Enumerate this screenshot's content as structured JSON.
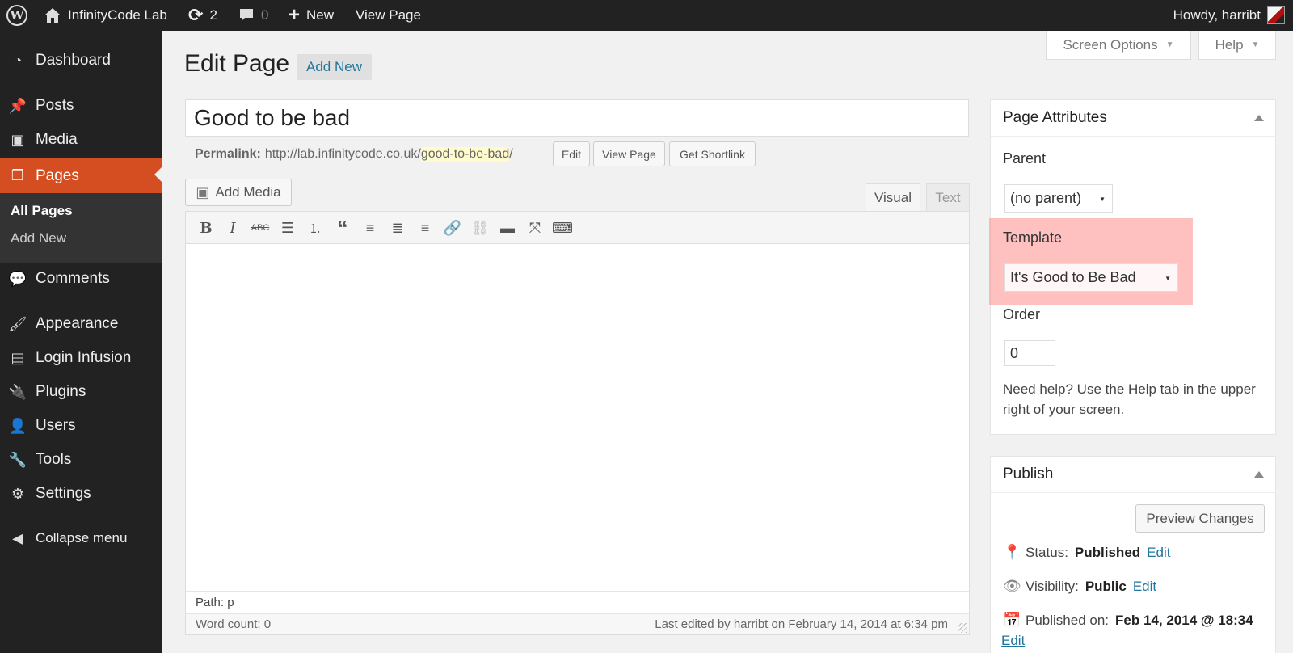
{
  "adminbar": {
    "site_name": "InfinityCode Lab",
    "updates_count": "2",
    "comments_count": "0",
    "new_label": "New",
    "view_page_label": "View Page",
    "howdy": "Howdy, harribt"
  },
  "sidebar": {
    "items": [
      {
        "label": "Dashboard",
        "icon": "dashboard-icon"
      },
      {
        "label": "Posts",
        "icon": "pushpin-icon"
      },
      {
        "label": "Media",
        "icon": "media-icon"
      },
      {
        "label": "Pages",
        "icon": "pages-icon"
      },
      {
        "label": "Comments",
        "icon": "comment-icon"
      },
      {
        "label": "Appearance",
        "icon": "brush-icon"
      },
      {
        "label": "Login Infusion",
        "icon": "plugin-custom-icon"
      },
      {
        "label": "Plugins",
        "icon": "plug-icon"
      },
      {
        "label": "Users",
        "icon": "user-icon"
      },
      {
        "label": "Tools",
        "icon": "wrench-icon"
      },
      {
        "label": "Settings",
        "icon": "settings-icon"
      }
    ],
    "submenu": [
      "All Pages",
      "Add New"
    ],
    "collapse_label": "Collapse menu"
  },
  "header": {
    "title": "Edit Page",
    "add_new": "Add New",
    "screen_options": "Screen Options",
    "help": "Help"
  },
  "post": {
    "title": "Good to be bad",
    "permalink_label": "Permalink:",
    "permalink_base": "http://lab.infinitycode.co.uk/",
    "permalink_slug": "good-to-be-bad",
    "permalink_end": "/",
    "edit_btn": "Edit",
    "view_page_btn": "View Page",
    "shortlink_btn": "Get Shortlink"
  },
  "editor": {
    "add_media": "Add Media",
    "tab_visual": "Visual",
    "tab_text": "Text",
    "path": "Path: p",
    "word_count": "Word count: 0",
    "last_edited": "Last edited by harribt on February 14, 2014 at 6:34 pm"
  },
  "page_attributes": {
    "title": "Page Attributes",
    "parent_label": "Parent",
    "parent_value": "(no parent)",
    "template_label": "Template",
    "template_value": "It's Good to Be Bad",
    "order_label": "Order",
    "order_value": "0",
    "help_text": "Need help? Use the Help tab in the upper right of your screen."
  },
  "publish": {
    "title": "Publish",
    "preview_btn": "Preview Changes",
    "status_label": "Status:",
    "status_value": "Published",
    "visibility_label": "Visibility:",
    "visibility_value": "Public",
    "published_label": "Published on:",
    "published_value": "Feb 14, 2014 @ 18:34",
    "edit_link": "Edit"
  },
  "colors": {
    "current_menu": "#d54e21",
    "link": "#21759b",
    "highlight": "#ff8c8c"
  }
}
